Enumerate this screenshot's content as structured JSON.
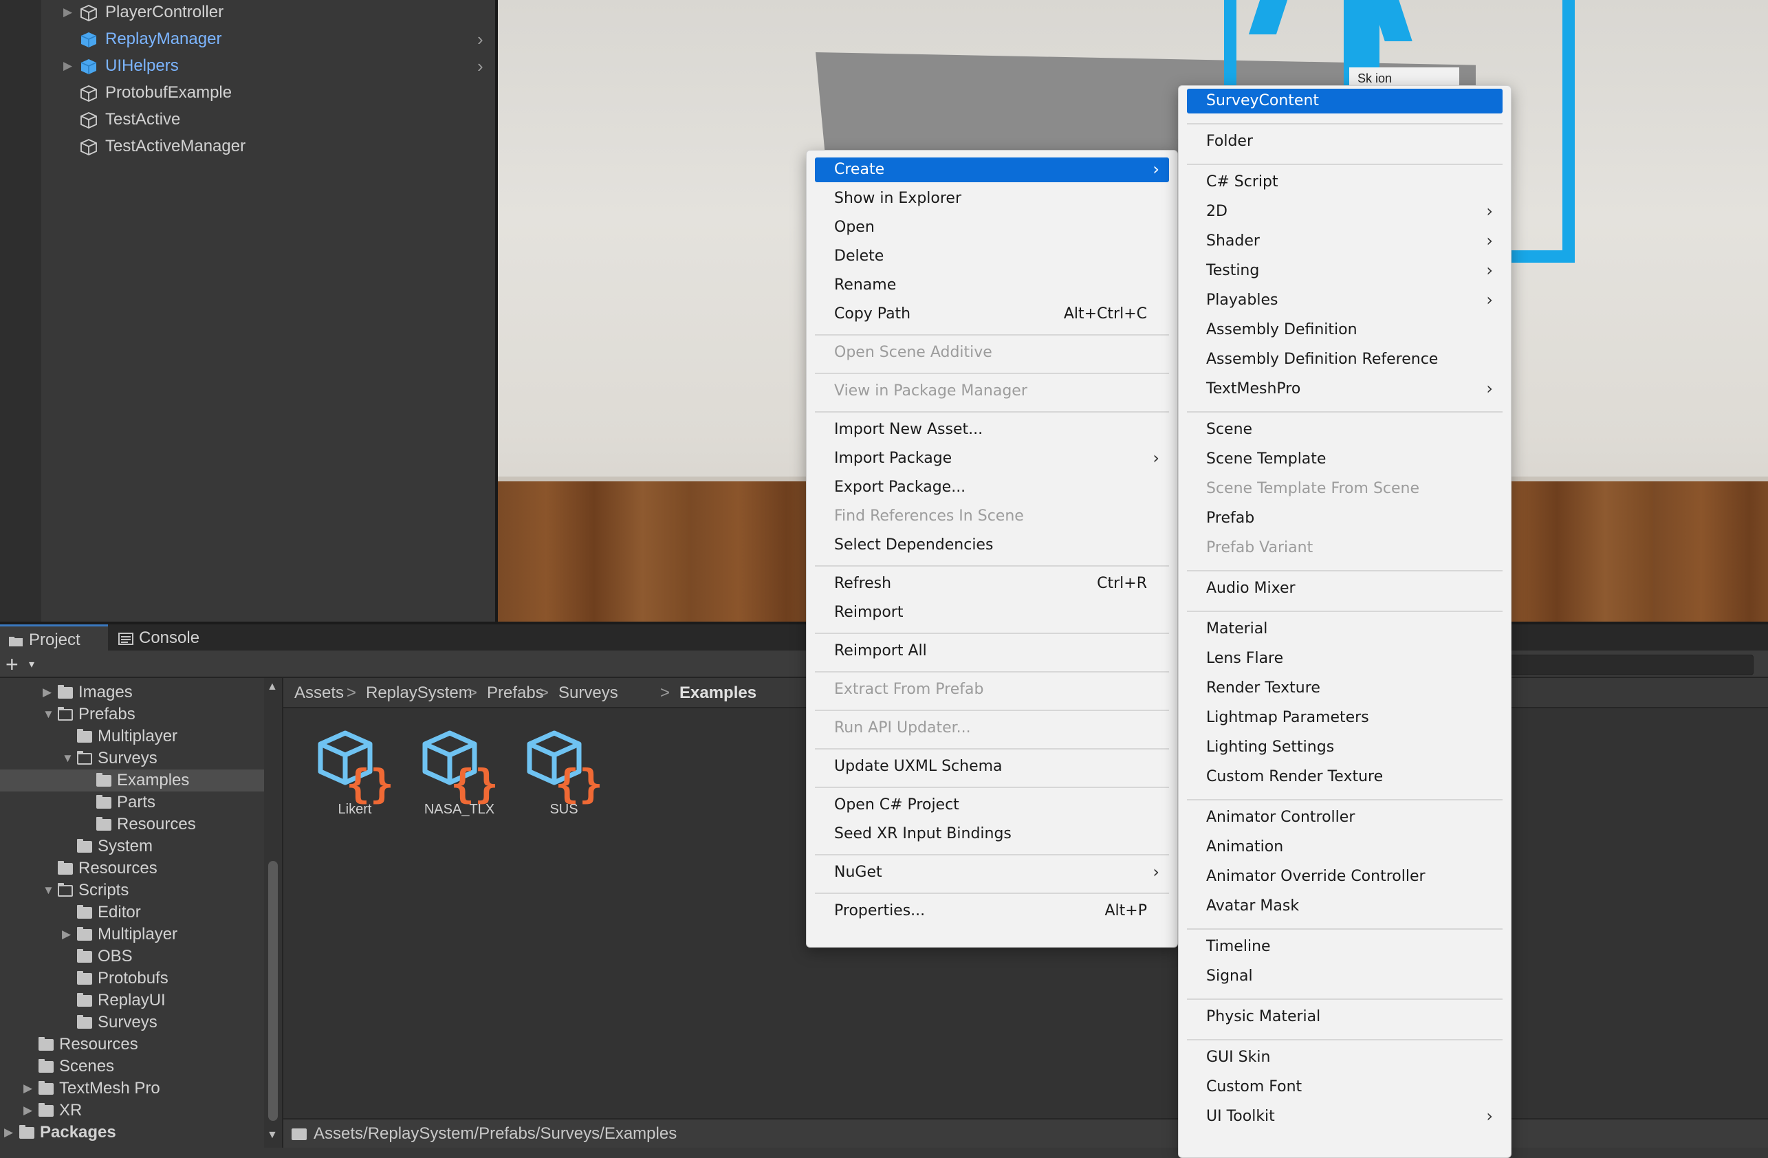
{
  "hierarchy": {
    "items": [
      {
        "label": "PlayerController",
        "kind": "gameobject",
        "blue": false,
        "has_arrow": true,
        "has_chevron": false
      },
      {
        "label": "ReplayManager",
        "kind": "prefab",
        "blue": true,
        "has_arrow": false,
        "has_chevron": true
      },
      {
        "label": "UIHelpers",
        "kind": "prefab",
        "blue": true,
        "has_arrow": true,
        "has_chevron": true
      },
      {
        "label": "ProtobufExample",
        "kind": "gameobject",
        "blue": false,
        "has_arrow": false,
        "has_chevron": false
      },
      {
        "label": "TestActive",
        "kind": "gameobject",
        "blue": false,
        "has_arrow": false,
        "has_chevron": false
      },
      {
        "label": "TestActiveManager",
        "kind": "gameobject",
        "blue": false,
        "has_arrow": false,
        "has_chevron": false
      }
    ]
  },
  "scene": {
    "partial_label": "Sk          ion"
  },
  "tabs": {
    "project": "Project",
    "console": "Console"
  },
  "toolbar": {
    "add_symbol": "+",
    "add_caret": "▾"
  },
  "tree": {
    "items": [
      {
        "label": "Images",
        "indent": 1,
        "arrow": "▶",
        "open": false,
        "selected": false,
        "bold": false
      },
      {
        "label": "Prefabs",
        "indent": 1,
        "arrow": "▼",
        "open": true,
        "selected": false,
        "bold": false
      },
      {
        "label": "Multiplayer",
        "indent": 2,
        "arrow": "",
        "open": false,
        "selected": false,
        "bold": false
      },
      {
        "label": "Surveys",
        "indent": 2,
        "arrow": "▼",
        "open": true,
        "selected": false,
        "bold": false
      },
      {
        "label": "Examples",
        "indent": 3,
        "arrow": "",
        "open": false,
        "selected": true,
        "bold": false
      },
      {
        "label": "Parts",
        "indent": 3,
        "arrow": "",
        "open": false,
        "selected": false,
        "bold": false
      },
      {
        "label": "Resources",
        "indent": 3,
        "arrow": "",
        "open": false,
        "selected": false,
        "bold": false
      },
      {
        "label": "System",
        "indent": 2,
        "arrow": "",
        "open": false,
        "selected": false,
        "bold": false
      },
      {
        "label": "Resources",
        "indent": 1,
        "arrow": "",
        "open": false,
        "selected": false,
        "bold": false
      },
      {
        "label": "Scripts",
        "indent": 1,
        "arrow": "▼",
        "open": true,
        "selected": false,
        "bold": false
      },
      {
        "label": "Editor",
        "indent": 2,
        "arrow": "",
        "open": false,
        "selected": false,
        "bold": false
      },
      {
        "label": "Multiplayer",
        "indent": 2,
        "arrow": "▶",
        "open": false,
        "selected": false,
        "bold": false
      },
      {
        "label": "OBS",
        "indent": 2,
        "arrow": "",
        "open": false,
        "selected": false,
        "bold": false
      },
      {
        "label": "Protobufs",
        "indent": 2,
        "arrow": "",
        "open": false,
        "selected": false,
        "bold": false
      },
      {
        "label": "ReplayUI",
        "indent": 2,
        "arrow": "",
        "open": false,
        "selected": false,
        "bold": false
      },
      {
        "label": "Surveys",
        "indent": 2,
        "arrow": "",
        "open": false,
        "selected": false,
        "bold": false
      },
      {
        "label": "Resources",
        "indent": 0,
        "arrow": "",
        "open": false,
        "selected": false,
        "bold": false
      },
      {
        "label": "Scenes",
        "indent": 0,
        "arrow": "",
        "open": false,
        "selected": false,
        "bold": false
      },
      {
        "label": "TextMesh Pro",
        "indent": 0,
        "arrow": "▶",
        "open": false,
        "selected": false,
        "bold": false
      },
      {
        "label": "XR",
        "indent": 0,
        "arrow": "▶",
        "open": false,
        "selected": false,
        "bold": false
      },
      {
        "label": "Packages",
        "indent": -1,
        "arrow": "▶",
        "open": false,
        "selected": false,
        "bold": true
      }
    ]
  },
  "breadcrumb": [
    "Assets",
    "ReplaySystem",
    "Prefabs",
    "Surveys",
    "Examples"
  ],
  "assets": [
    "Likert",
    "NASA_TLX",
    "SUS"
  ],
  "path": "Assets/ReplaySystem/Prefabs/Surveys/Examples",
  "context_menu": {
    "items": [
      {
        "label": "Create",
        "shortcut": "",
        "submenu": true,
        "disabled": false,
        "highlighted": true,
        "sep_after": false
      },
      {
        "label": "Show in Explorer",
        "shortcut": "",
        "submenu": false,
        "disabled": false,
        "highlighted": false,
        "sep_after": false
      },
      {
        "label": "Open",
        "shortcut": "",
        "submenu": false,
        "disabled": false,
        "highlighted": false,
        "sep_after": false
      },
      {
        "label": "Delete",
        "shortcut": "",
        "submenu": false,
        "disabled": false,
        "highlighted": false,
        "sep_after": false
      },
      {
        "label": "Rename",
        "shortcut": "",
        "submenu": false,
        "disabled": false,
        "highlighted": false,
        "sep_after": false
      },
      {
        "label": "Copy Path",
        "shortcut": "Alt+Ctrl+C",
        "submenu": false,
        "disabled": false,
        "highlighted": false,
        "sep_after": true
      },
      {
        "label": "Open Scene Additive",
        "shortcut": "",
        "submenu": false,
        "disabled": true,
        "highlighted": false,
        "sep_after": true
      },
      {
        "label": "View in Package Manager",
        "shortcut": "",
        "submenu": false,
        "disabled": true,
        "highlighted": false,
        "sep_after": true
      },
      {
        "label": "Import New Asset...",
        "shortcut": "",
        "submenu": false,
        "disabled": false,
        "highlighted": false,
        "sep_after": false
      },
      {
        "label": "Import Package",
        "shortcut": "",
        "submenu": true,
        "disabled": false,
        "highlighted": false,
        "sep_after": false
      },
      {
        "label": "Export Package...",
        "shortcut": "",
        "submenu": false,
        "disabled": false,
        "highlighted": false,
        "sep_after": false
      },
      {
        "label": "Find References In Scene",
        "shortcut": "",
        "submenu": false,
        "disabled": true,
        "highlighted": false,
        "sep_after": false
      },
      {
        "label": "Select Dependencies",
        "shortcut": "",
        "submenu": false,
        "disabled": false,
        "highlighted": false,
        "sep_after": true
      },
      {
        "label": "Refresh",
        "shortcut": "Ctrl+R",
        "submenu": false,
        "disabled": false,
        "highlighted": false,
        "sep_after": false
      },
      {
        "label": "Reimport",
        "shortcut": "",
        "submenu": false,
        "disabled": false,
        "highlighted": false,
        "sep_after": true
      },
      {
        "label": "Reimport All",
        "shortcut": "",
        "submenu": false,
        "disabled": false,
        "highlighted": false,
        "sep_after": true
      },
      {
        "label": "Extract From Prefab",
        "shortcut": "",
        "submenu": false,
        "disabled": true,
        "highlighted": false,
        "sep_after": true
      },
      {
        "label": "Run API Updater...",
        "shortcut": "",
        "submenu": false,
        "disabled": true,
        "highlighted": false,
        "sep_after": true
      },
      {
        "label": "Update UXML Schema",
        "shortcut": "",
        "submenu": false,
        "disabled": false,
        "highlighted": false,
        "sep_after": true
      },
      {
        "label": "Open C# Project",
        "shortcut": "",
        "submenu": false,
        "disabled": false,
        "highlighted": false,
        "sep_after": false
      },
      {
        "label": "Seed XR Input Bindings",
        "shortcut": "",
        "submenu": false,
        "disabled": false,
        "highlighted": false,
        "sep_after": true
      },
      {
        "label": "NuGet",
        "shortcut": "",
        "submenu": true,
        "disabled": false,
        "highlighted": false,
        "sep_after": true
      },
      {
        "label": "Properties...",
        "shortcut": "Alt+P",
        "submenu": false,
        "disabled": false,
        "highlighted": false,
        "sep_after": false
      }
    ]
  },
  "create_submenu": {
    "items": [
      {
        "label": "SurveyContent",
        "submenu": false,
        "disabled": false,
        "highlighted": true,
        "sep_after": true
      },
      {
        "label": "Folder",
        "submenu": false,
        "disabled": false,
        "highlighted": false,
        "sep_after": true
      },
      {
        "label": "C# Script",
        "submenu": false,
        "disabled": false,
        "highlighted": false,
        "sep_after": false
      },
      {
        "label": "2D",
        "submenu": true,
        "disabled": false,
        "highlighted": false,
        "sep_after": false
      },
      {
        "label": "Shader",
        "submenu": true,
        "disabled": false,
        "highlighted": false,
        "sep_after": false
      },
      {
        "label": "Testing",
        "submenu": true,
        "disabled": false,
        "highlighted": false,
        "sep_after": false
      },
      {
        "label": "Playables",
        "submenu": true,
        "disabled": false,
        "highlighted": false,
        "sep_after": false
      },
      {
        "label": "Assembly Definition",
        "submenu": false,
        "disabled": false,
        "highlighted": false,
        "sep_after": false
      },
      {
        "label": "Assembly Definition Reference",
        "submenu": false,
        "disabled": false,
        "highlighted": false,
        "sep_after": false
      },
      {
        "label": "TextMeshPro",
        "submenu": true,
        "disabled": false,
        "highlighted": false,
        "sep_after": true
      },
      {
        "label": "Scene",
        "submenu": false,
        "disabled": false,
        "highlighted": false,
        "sep_after": false
      },
      {
        "label": "Scene Template",
        "submenu": false,
        "disabled": false,
        "highlighted": false,
        "sep_after": false
      },
      {
        "label": "Scene Template From Scene",
        "submenu": false,
        "disabled": true,
        "highlighted": false,
        "sep_after": false
      },
      {
        "label": "Prefab",
        "submenu": false,
        "disabled": false,
        "highlighted": false,
        "sep_after": false
      },
      {
        "label": "Prefab Variant",
        "submenu": false,
        "disabled": true,
        "highlighted": false,
        "sep_after": true
      },
      {
        "label": "Audio Mixer",
        "submenu": false,
        "disabled": false,
        "highlighted": false,
        "sep_after": true
      },
      {
        "label": "Material",
        "submenu": false,
        "disabled": false,
        "highlighted": false,
        "sep_after": false
      },
      {
        "label": "Lens Flare",
        "submenu": false,
        "disabled": false,
        "highlighted": false,
        "sep_after": false
      },
      {
        "label": "Render Texture",
        "submenu": false,
        "disabled": false,
        "highlighted": false,
        "sep_after": false
      },
      {
        "label": "Lightmap Parameters",
        "submenu": false,
        "disabled": false,
        "highlighted": false,
        "sep_after": false
      },
      {
        "label": "Lighting Settings",
        "submenu": false,
        "disabled": false,
        "highlighted": false,
        "sep_after": false
      },
      {
        "label": "Custom Render Texture",
        "submenu": false,
        "disabled": false,
        "highlighted": false,
        "sep_after": true
      },
      {
        "label": "Animator Controller",
        "submenu": false,
        "disabled": false,
        "highlighted": false,
        "sep_after": false
      },
      {
        "label": "Animation",
        "submenu": false,
        "disabled": false,
        "highlighted": false,
        "sep_after": false
      },
      {
        "label": "Animator Override Controller",
        "submenu": false,
        "disabled": false,
        "highlighted": false,
        "sep_after": false
      },
      {
        "label": "Avatar Mask",
        "submenu": false,
        "disabled": false,
        "highlighted": false,
        "sep_after": true
      },
      {
        "label": "Timeline",
        "submenu": false,
        "disabled": false,
        "highlighted": false,
        "sep_after": false
      },
      {
        "label": "Signal",
        "submenu": false,
        "disabled": false,
        "highlighted": false,
        "sep_after": true
      },
      {
        "label": "Physic Material",
        "submenu": false,
        "disabled": false,
        "highlighted": false,
        "sep_after": true
      },
      {
        "label": "GUI Skin",
        "submenu": false,
        "disabled": false,
        "highlighted": false,
        "sep_after": false
      },
      {
        "label": "Custom Font",
        "submenu": false,
        "disabled": false,
        "highlighted": false,
        "sep_after": false
      },
      {
        "label": "UI Toolkit",
        "submenu": true,
        "disabled": false,
        "highlighted": false,
        "sep_after": false
      }
    ]
  },
  "colors": {
    "accent": "#0b6dd8",
    "prefab_blue": "#7cb5ff",
    "scene_blue": "#18a7e8",
    "asset_cube": "#6fc3f2",
    "asset_braces": "#f06a35"
  },
  "icons": {
    "cube": "cube-icon",
    "prefab": "prefab-cube-icon",
    "folder": "folder-icon",
    "asset": "scriptable-object-icon",
    "submenu": "chevron-right-icon"
  }
}
